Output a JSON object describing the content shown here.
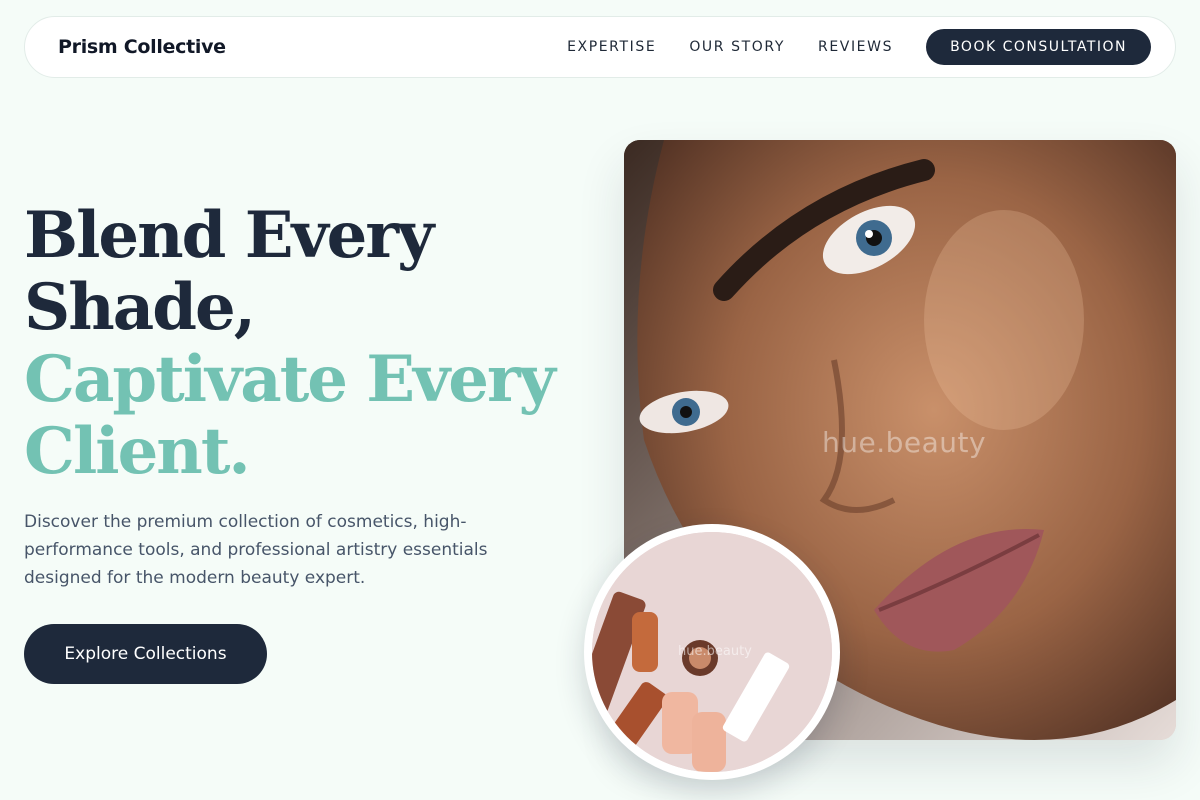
{
  "header": {
    "brand": "Prism Collective",
    "nav": [
      "EXPERTISE",
      "OUR STORY",
      "REVIEWS"
    ],
    "cta": "BOOK CONSULTATION"
  },
  "hero": {
    "title_line1": "Blend Every",
    "title_line2": "Shade,",
    "title_line3": "Captivate Every",
    "title_line4": "Client.",
    "description": "Discover the premium collection of cosmetics, high-performance tools, and professional artistry essentials designed for the modern beauty expert.",
    "button": "Explore Collections"
  },
  "images": {
    "main_watermark": "hue.beauty",
    "inset_watermark": "hue.beauty"
  },
  "colors": {
    "background": "#f5fcf8",
    "primary_dark": "#1e293b",
    "accent_teal": "#73c2b3",
    "text_muted": "#475569"
  }
}
